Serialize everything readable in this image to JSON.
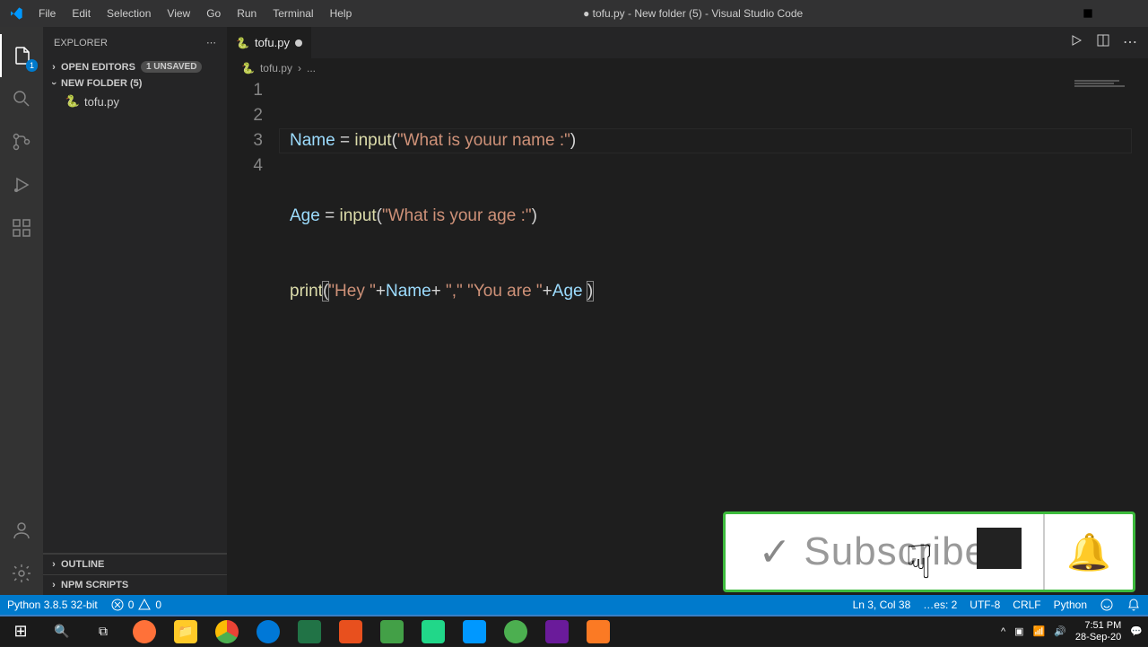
{
  "window": {
    "title": "● tofu.py - New folder (5) - Visual Studio Code"
  },
  "menu": {
    "file": "File",
    "edit": "Edit",
    "selection": "Selection",
    "view": "View",
    "go": "Go",
    "run": "Run",
    "terminal": "Terminal",
    "help": "Help"
  },
  "explorer": {
    "title": "EXPLORER",
    "open_editors": "OPEN EDITORS",
    "unsaved_badge": "1 UNSAVED",
    "folder": "NEW FOLDER (5)",
    "file1": "tofu.py",
    "outline": "OUTLINE",
    "npm": "NPM SCRIPTS"
  },
  "tab": {
    "name": "tofu.py"
  },
  "breadcrumb": {
    "file": "tofu.py",
    "more": "..."
  },
  "code": {
    "line1": {
      "var": "Name",
      "eq": " = ",
      "fn": "input",
      "lp": "(",
      "str": "\"What is youur name :\"",
      "rp": ")"
    },
    "line2": {
      "var": "Age",
      "eq": " = ",
      "fn": "input",
      "lp": "(",
      "str": "\"What is your age :\"",
      "rp": ")"
    },
    "line3": {
      "fn": "print",
      "lp": "(",
      "s1": "\"Hey \"",
      "p1": "+",
      "v1": "Name",
      "p2": "+ ",
      "s2": "\",\"",
      "sp": " ",
      "s3": "\"You are \"",
      "p3": "+",
      "v2": "Age",
      "sp2": " ",
      "rp": ")"
    },
    "ln1": "1",
    "ln2": "2",
    "ln3": "3",
    "ln4": "4"
  },
  "status": {
    "python": "Python 3.8.5 32-bit",
    "errors": "0",
    "warnings": "0",
    "position": "Ln 3, Col 38",
    "spaces": "…es: 2",
    "encoding": "UTF-8",
    "eol": "CRLF",
    "lang": "Python"
  },
  "overlay": {
    "text": "Subscribed"
  },
  "clock": {
    "time": "7:51 PM",
    "date": "28-Sep-20"
  },
  "activity_badge": "1"
}
